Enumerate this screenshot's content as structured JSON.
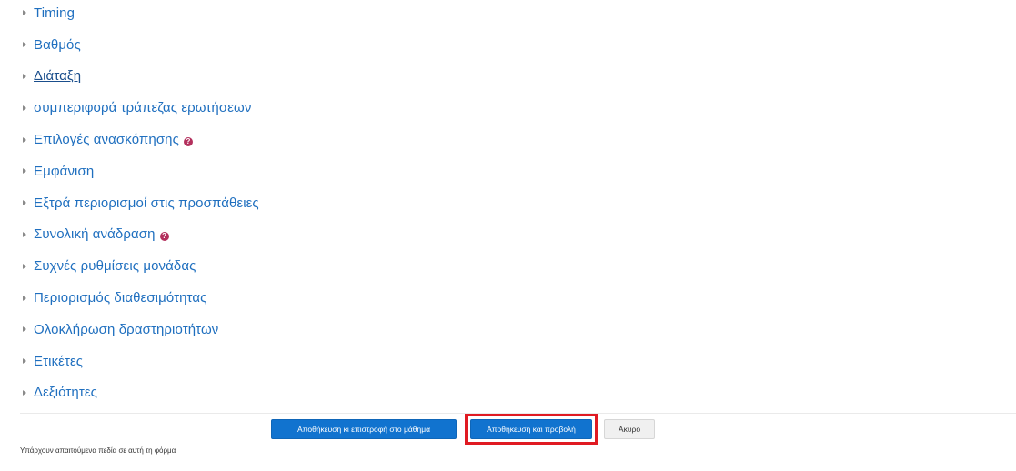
{
  "sections": [
    {
      "label": "Timing",
      "underlined": false,
      "help": false
    },
    {
      "label": "Βαθμός",
      "underlined": false,
      "help": false
    },
    {
      "label": "Διάταξη",
      "underlined": true,
      "help": false
    },
    {
      "label": "συμπεριφορά τράπεζας ερωτήσεων",
      "underlined": false,
      "help": false
    },
    {
      "label": "Επιλογές ανασκόπησης",
      "underlined": false,
      "help": true
    },
    {
      "label": "Εμφάνιση",
      "underlined": false,
      "help": false
    },
    {
      "label": "Εξτρά περιορισμοί στις προσπάθειες",
      "underlined": false,
      "help": false
    },
    {
      "label": "Συνολική ανάδραση",
      "underlined": false,
      "help": true
    },
    {
      "label": "Συχνές ρυθμίσεις μονάδας",
      "underlined": false,
      "help": false
    },
    {
      "label": "Περιορισμός διαθεσιμότητας",
      "underlined": false,
      "help": false
    },
    {
      "label": "Ολοκλήρωση δραστηριοτήτων",
      "underlined": false,
      "help": false
    },
    {
      "label": "Ετικέτες",
      "underlined": false,
      "help": false
    },
    {
      "label": "Δεξιότητες",
      "underlined": false,
      "help": false
    }
  ],
  "icons": {
    "expand": "chevron-right-icon",
    "help": "question-circle-icon"
  },
  "help_glyph": "?",
  "buttons": {
    "save_return": "Αποθήκευση κι επιστροφή στο μάθημα",
    "save_display": "Αποθήκευση και προβολή",
    "cancel": "Άκυρο"
  },
  "footer": {
    "required_note": "Υπάρχουν απαιτούμενα πεδία σε αυτή τη φόρμα"
  },
  "colors": {
    "link": "#1f6fbf",
    "primary_button": "#1173cf",
    "highlight_border": "#e01a22",
    "help_icon": "#b3305d"
  }
}
